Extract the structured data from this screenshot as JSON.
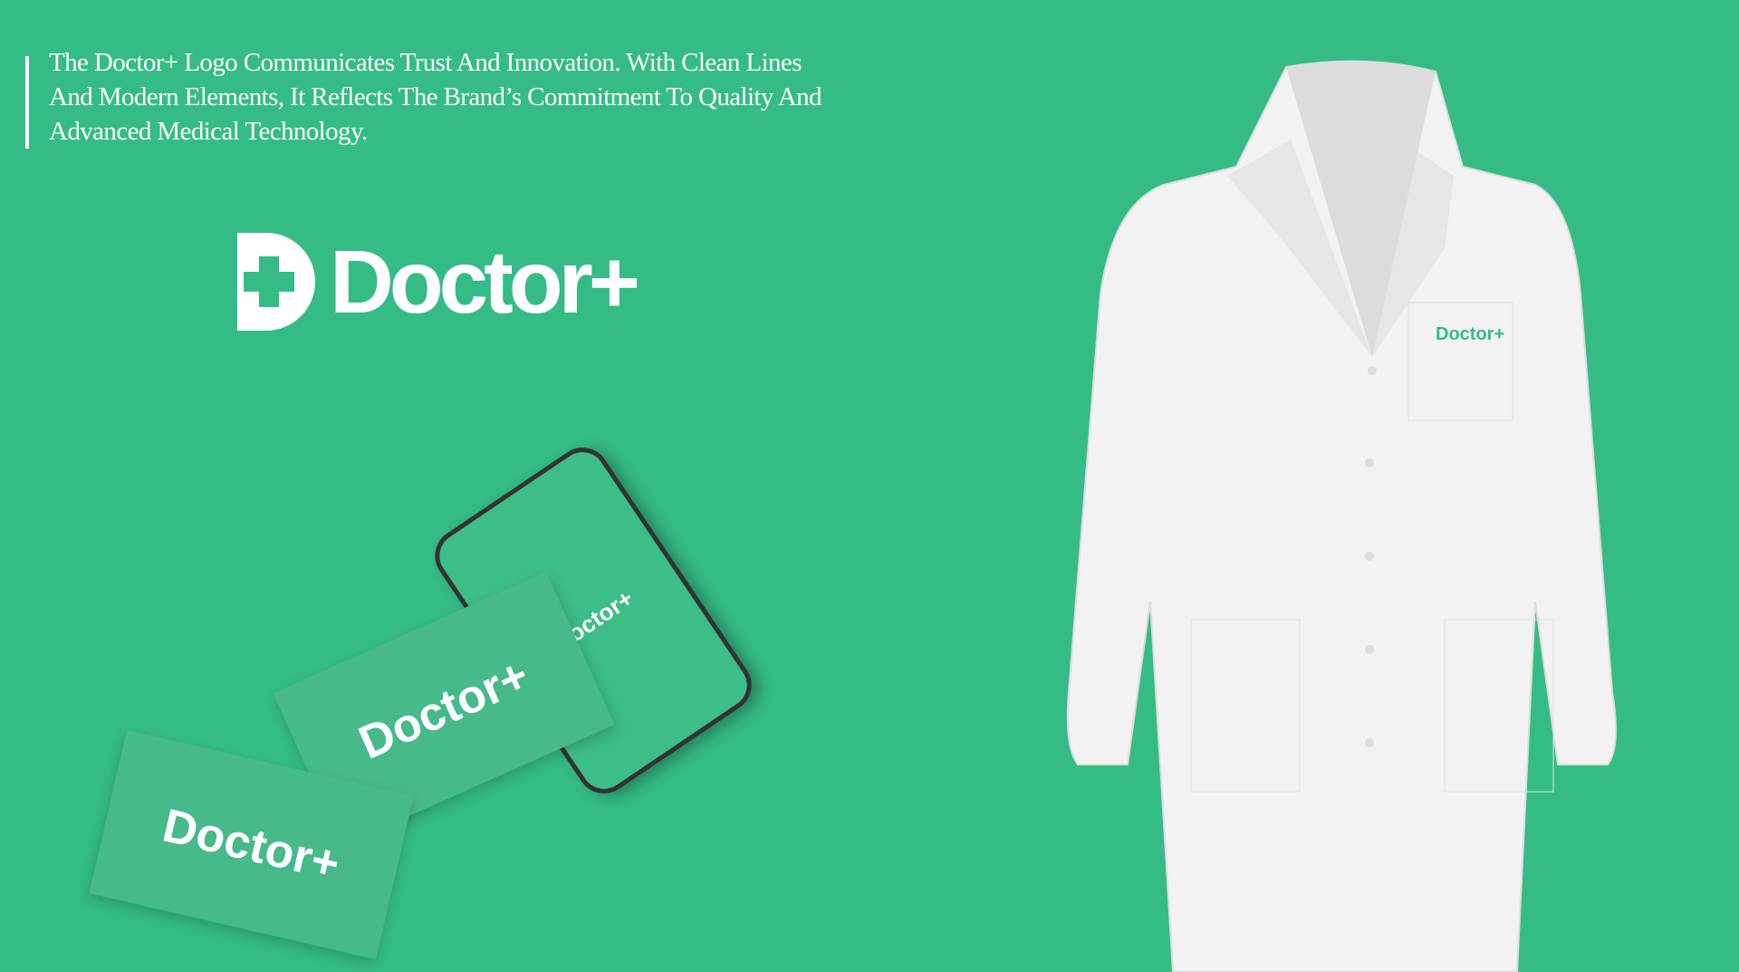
{
  "description": "The Doctor+ Logo Communicates Trust And Innovation. With Clean Lines And Modern Elements, It Reflects The Brand’s Commitment To Quality And Advanced Medical Technology.",
  "brand": {
    "name": "Doctor+",
    "color": "#35bc86"
  },
  "mockups": {
    "phone_logo": "Doctor+",
    "card1_logo": "Doctor+",
    "card2_logo": "Doctor+",
    "coat_logo": "Doctor+"
  }
}
